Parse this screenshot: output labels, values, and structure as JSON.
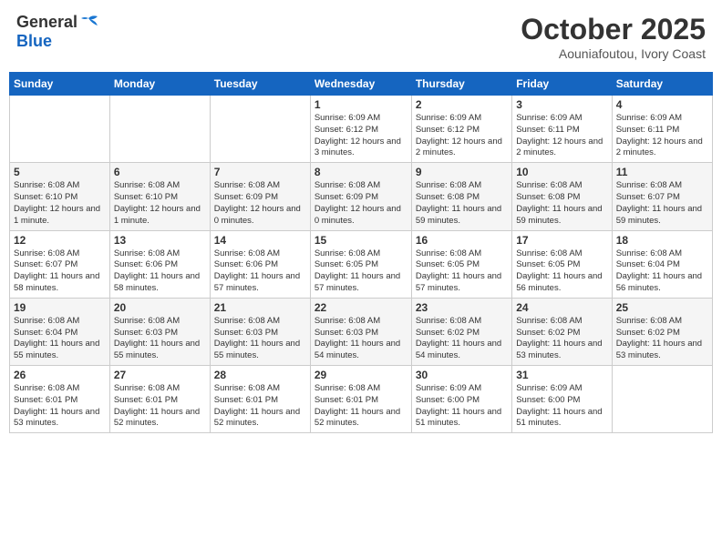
{
  "logo": {
    "general": "General",
    "blue": "Blue"
  },
  "title": "October 2025",
  "subtitle": "Aouniafoutou, Ivory Coast",
  "weekdays": [
    "Sunday",
    "Monday",
    "Tuesday",
    "Wednesday",
    "Thursday",
    "Friday",
    "Saturday"
  ],
  "weeks": [
    [
      {
        "day": "",
        "info": ""
      },
      {
        "day": "",
        "info": ""
      },
      {
        "day": "",
        "info": ""
      },
      {
        "day": "1",
        "info": "Sunrise: 6:09 AM\nSunset: 6:12 PM\nDaylight: 12 hours and 3 minutes."
      },
      {
        "day": "2",
        "info": "Sunrise: 6:09 AM\nSunset: 6:12 PM\nDaylight: 12 hours and 2 minutes."
      },
      {
        "day": "3",
        "info": "Sunrise: 6:09 AM\nSunset: 6:11 PM\nDaylight: 12 hours and 2 minutes."
      },
      {
        "day": "4",
        "info": "Sunrise: 6:09 AM\nSunset: 6:11 PM\nDaylight: 12 hours and 2 minutes."
      }
    ],
    [
      {
        "day": "5",
        "info": "Sunrise: 6:08 AM\nSunset: 6:10 PM\nDaylight: 12 hours and 1 minute."
      },
      {
        "day": "6",
        "info": "Sunrise: 6:08 AM\nSunset: 6:10 PM\nDaylight: 12 hours and 1 minute."
      },
      {
        "day": "7",
        "info": "Sunrise: 6:08 AM\nSunset: 6:09 PM\nDaylight: 12 hours and 0 minutes."
      },
      {
        "day": "8",
        "info": "Sunrise: 6:08 AM\nSunset: 6:09 PM\nDaylight: 12 hours and 0 minutes."
      },
      {
        "day": "9",
        "info": "Sunrise: 6:08 AM\nSunset: 6:08 PM\nDaylight: 11 hours and 59 minutes."
      },
      {
        "day": "10",
        "info": "Sunrise: 6:08 AM\nSunset: 6:08 PM\nDaylight: 11 hours and 59 minutes."
      },
      {
        "day": "11",
        "info": "Sunrise: 6:08 AM\nSunset: 6:07 PM\nDaylight: 11 hours and 59 minutes."
      }
    ],
    [
      {
        "day": "12",
        "info": "Sunrise: 6:08 AM\nSunset: 6:07 PM\nDaylight: 11 hours and 58 minutes."
      },
      {
        "day": "13",
        "info": "Sunrise: 6:08 AM\nSunset: 6:06 PM\nDaylight: 11 hours and 58 minutes."
      },
      {
        "day": "14",
        "info": "Sunrise: 6:08 AM\nSunset: 6:06 PM\nDaylight: 11 hours and 57 minutes."
      },
      {
        "day": "15",
        "info": "Sunrise: 6:08 AM\nSunset: 6:05 PM\nDaylight: 11 hours and 57 minutes."
      },
      {
        "day": "16",
        "info": "Sunrise: 6:08 AM\nSunset: 6:05 PM\nDaylight: 11 hours and 57 minutes."
      },
      {
        "day": "17",
        "info": "Sunrise: 6:08 AM\nSunset: 6:05 PM\nDaylight: 11 hours and 56 minutes."
      },
      {
        "day": "18",
        "info": "Sunrise: 6:08 AM\nSunset: 6:04 PM\nDaylight: 11 hours and 56 minutes."
      }
    ],
    [
      {
        "day": "19",
        "info": "Sunrise: 6:08 AM\nSunset: 6:04 PM\nDaylight: 11 hours and 55 minutes."
      },
      {
        "day": "20",
        "info": "Sunrise: 6:08 AM\nSunset: 6:03 PM\nDaylight: 11 hours and 55 minutes."
      },
      {
        "day": "21",
        "info": "Sunrise: 6:08 AM\nSunset: 6:03 PM\nDaylight: 11 hours and 55 minutes."
      },
      {
        "day": "22",
        "info": "Sunrise: 6:08 AM\nSunset: 6:03 PM\nDaylight: 11 hours and 54 minutes."
      },
      {
        "day": "23",
        "info": "Sunrise: 6:08 AM\nSunset: 6:02 PM\nDaylight: 11 hours and 54 minutes."
      },
      {
        "day": "24",
        "info": "Sunrise: 6:08 AM\nSunset: 6:02 PM\nDaylight: 11 hours and 53 minutes."
      },
      {
        "day": "25",
        "info": "Sunrise: 6:08 AM\nSunset: 6:02 PM\nDaylight: 11 hours and 53 minutes."
      }
    ],
    [
      {
        "day": "26",
        "info": "Sunrise: 6:08 AM\nSunset: 6:01 PM\nDaylight: 11 hours and 53 minutes."
      },
      {
        "day": "27",
        "info": "Sunrise: 6:08 AM\nSunset: 6:01 PM\nDaylight: 11 hours and 52 minutes."
      },
      {
        "day": "28",
        "info": "Sunrise: 6:08 AM\nSunset: 6:01 PM\nDaylight: 11 hours and 52 minutes."
      },
      {
        "day": "29",
        "info": "Sunrise: 6:08 AM\nSunset: 6:01 PM\nDaylight: 11 hours and 52 minutes."
      },
      {
        "day": "30",
        "info": "Sunrise: 6:09 AM\nSunset: 6:00 PM\nDaylight: 11 hours and 51 minutes."
      },
      {
        "day": "31",
        "info": "Sunrise: 6:09 AM\nSunset: 6:00 PM\nDaylight: 11 hours and 51 minutes."
      },
      {
        "day": "",
        "info": ""
      }
    ]
  ]
}
